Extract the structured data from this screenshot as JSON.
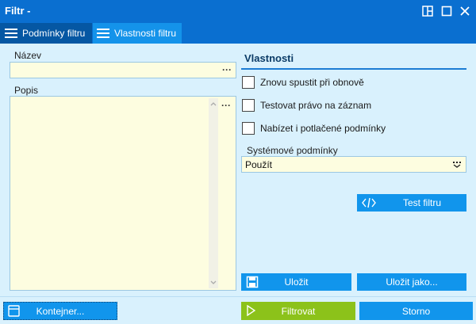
{
  "window": {
    "title": "Filtr -"
  },
  "tabs": [
    {
      "label": "Podmínky filtru",
      "icon": "hamburger-icon"
    },
    {
      "label": "Vlastnosti filtru",
      "icon": "hamburger-icon"
    }
  ],
  "left": {
    "name_label": "Název",
    "name_value": "",
    "desc_label": "Popis",
    "desc_value": "",
    "ellipsis": "···"
  },
  "properties": {
    "title": "Vlastnosti",
    "checkboxes": [
      {
        "label": "Znovu spustit při obnově",
        "checked": false
      },
      {
        "label": "Testovat právo na záznam",
        "checked": false
      },
      {
        "label": "Nabízet i potlačené podmínky",
        "checked": false
      }
    ],
    "system_label": "Systémové podmínky",
    "system_value": "Použít",
    "test_button": "Test filtru",
    "save_button": "Uložit",
    "save_as_button": "Uložit jako..."
  },
  "footer": {
    "container_button": "Kontejner...",
    "filter_button": "Filtrovat",
    "cancel_button": "Storno"
  },
  "colors": {
    "window_blue": "#0a6fd0",
    "panel_bg": "#d9f1fd",
    "button_blue": "#1195ec",
    "filter_green": "#8cc21a",
    "field_yellow": "#fdfde0"
  }
}
